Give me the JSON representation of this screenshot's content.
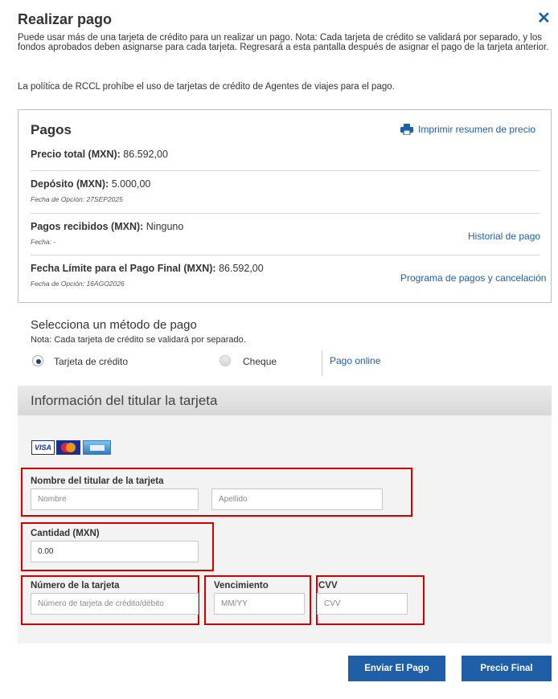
{
  "modal": {
    "title": "Realizar pago",
    "intro": "Puede usar más de una tarjeta de crédito para un realizar un pago. Nota: Cada tarjeta de crédito se validará por separado, y los fondos aprobados deben asignarse para cada tarjeta. Regresará a esta pantalla después de asignar el pago de la tarjeta anterior.",
    "policy": "La política de RCCL prohíbe el uso de tarjetas de crédito de Agentes de viajes para el pago.",
    "close_icon": "close-icon"
  },
  "pagos": {
    "title": "Pagos",
    "print_link": "Imprimir resumen de precio",
    "total_label": "Precio total (MXN):",
    "total_value": " 86.592,00",
    "deposit_label": "Depósito (MXN):",
    "deposit_value": " 5.000,00",
    "deposit_sub": "Fecha de Opción: 27SEP2025",
    "received_label": "Pagos recibidos (MXN):",
    "received_value": " Ninguno",
    "received_sub": "Fecha: -",
    "history_link": "Historial de pago",
    "final_label": "Fecha Límite para el Pago Final (MXN):",
    "final_value": " 86.592,00",
    "final_sub": "Fecha de Opción: 16AGO2026",
    "schedule_link": "Programa de pagos y cancelación"
  },
  "method": {
    "title": "Selecciona un método de pago",
    "note": "Nota: Cada tarjeta de crédito se validará por separado.",
    "options": [
      "Tarjeta de crédito",
      "Cheque"
    ],
    "selected": "Tarjeta de crédito",
    "online_link": "Pago online"
  },
  "cardholder": {
    "title": "Información del titular la tarjeta",
    "logos": [
      "VISA",
      "MasterCard",
      "AMEX"
    ],
    "name_label": "Nombre del titular de la tarjeta",
    "first_placeholder": "Nombre",
    "last_placeholder": "Apellido",
    "amount_label": "Cantidad (MXN)",
    "amount_value": "0.00",
    "card_label": "Número de la tarjeta",
    "card_placeholder": "Número de tarjeta de crédito/débito",
    "expiry_label": "Vencimiento",
    "expiry_placeholder": "MM/YY",
    "cvv_label": "CVV",
    "cvv_placeholder": "CVV"
  },
  "buttons": {
    "submit": "Enviar El Pago",
    "final_price": "Precio Final"
  },
  "colors": {
    "accent": "#1f5fa8",
    "highlight": "#d40000"
  }
}
